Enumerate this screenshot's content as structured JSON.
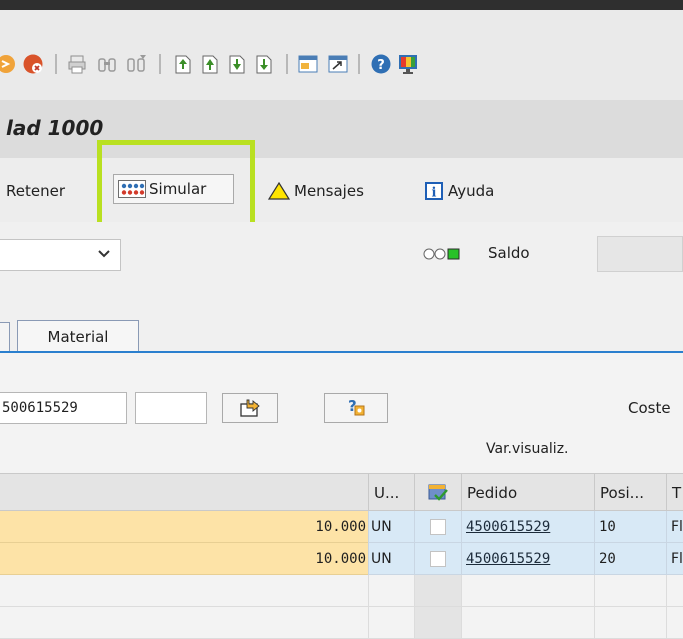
{
  "window": {
    "title": "lad 1000"
  },
  "app_toolbar": {
    "retener_label": "Retener",
    "simular_label": "Simular",
    "mensajes_label": "Mensajes",
    "ayuda_label": "Ayuda"
  },
  "header": {
    "saldo_label": "Saldo",
    "tab_material_label": "Material"
  },
  "filter": {
    "order_field_value": "500615529",
    "coste_label": "Coste",
    "var_visualiz_label": "Var.visualiz."
  },
  "grid": {
    "columns": {
      "unit": "U...",
      "pedido": "Pedido",
      "posicion": "Posi...",
      "t": "T"
    },
    "rows": [
      {
        "qty": "10.000",
        "unit": "UN",
        "pedido": "4500615529",
        "pos": "10",
        "t": "Fl"
      },
      {
        "qty": "10.000",
        "unit": "UN",
        "pedido": "4500615529",
        "pos": "20",
        "t": "Fl"
      }
    ]
  },
  "colors": {
    "row_yellow": "#fde3a7",
    "row_blue": "#d8e9f6",
    "highlight_green": "#b9e021",
    "tab_line_blue": "#2a7fce"
  }
}
